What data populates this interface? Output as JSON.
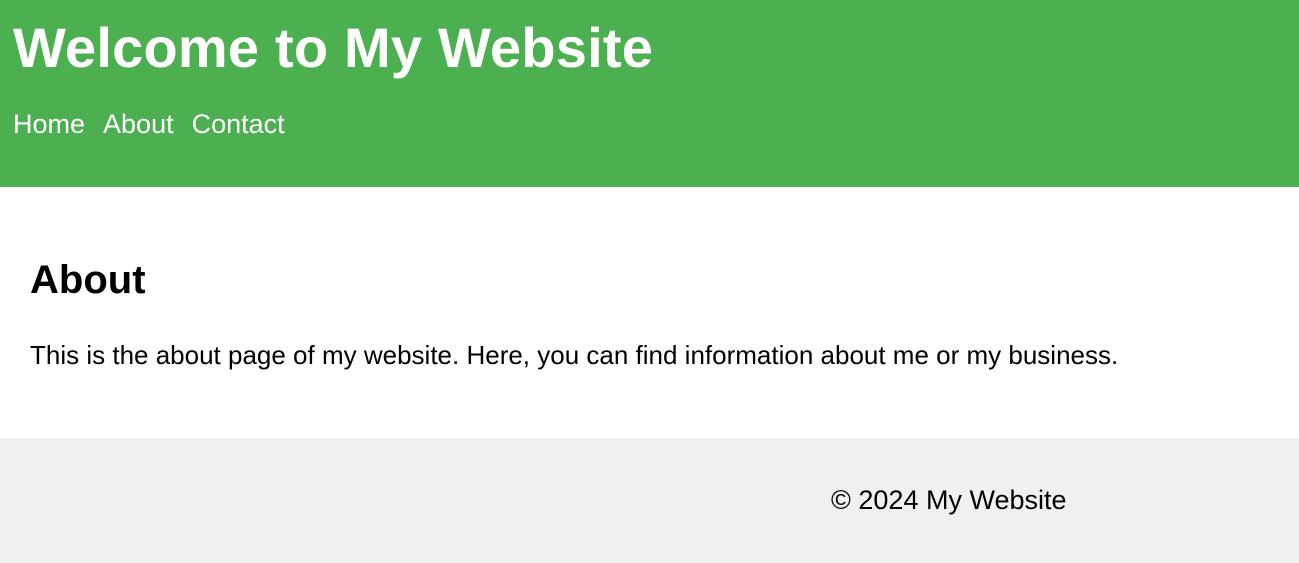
{
  "header": {
    "title": "Welcome to My Website",
    "nav": [
      {
        "label": "Home"
      },
      {
        "label": "About"
      },
      {
        "label": "Contact"
      }
    ],
    "background_color": "#4CAF50"
  },
  "main": {
    "heading": "About",
    "paragraph": "This is the about page of my website. Here, you can find information about me or my business."
  },
  "footer": {
    "text": "© 2024 My Website",
    "background_color": "#f0f0f0"
  }
}
